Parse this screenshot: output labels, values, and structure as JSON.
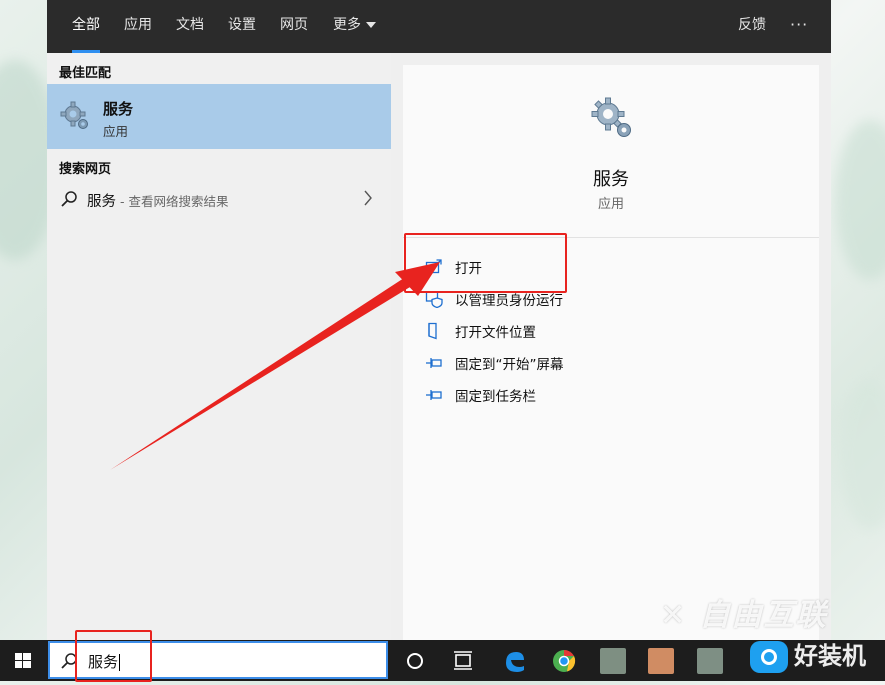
{
  "tabs": [
    {
      "label": "全部",
      "active": true
    },
    {
      "label": "应用"
    },
    {
      "label": "文档"
    },
    {
      "label": "设置"
    },
    {
      "label": "网页"
    },
    {
      "label": "更多"
    }
  ],
  "topbar": {
    "feedback_label": "反馈",
    "more_options": "···"
  },
  "left": {
    "best_match_title": "最佳匹配",
    "best_match": {
      "name": "服务",
      "type": "应用",
      "icon": "gear-icon"
    },
    "web_title": "搜索网页",
    "web_result": {
      "query": "服务",
      "hint": " - 查看网络搜索结果"
    }
  },
  "right": {
    "app_name": "服务",
    "app_type": "应用",
    "icon": "gear-icon",
    "actions": [
      {
        "label": "打开",
        "icon": "open-icon"
      },
      {
        "label": "以管理员身份运行",
        "icon": "admin-shield-icon"
      },
      {
        "label": "打开文件位置",
        "icon": "file-location-icon"
      },
      {
        "label": "固定到“开始”屏幕",
        "icon": "pin-icon"
      },
      {
        "label": "固定到任务栏",
        "icon": "pin-icon"
      }
    ]
  },
  "taskbar": {
    "search_value": "服务",
    "icons": [
      "windows-logo-icon",
      "cortana-icon",
      "task-view-icon",
      "edge-icon",
      "chrome-icon"
    ]
  },
  "watermark": {
    "brand1": "自由互联",
    "brand2": "好装机"
  },
  "colors": {
    "accent": "#2f8ff0",
    "selection": "#a9cbe9",
    "annotation": "#e8231f"
  }
}
